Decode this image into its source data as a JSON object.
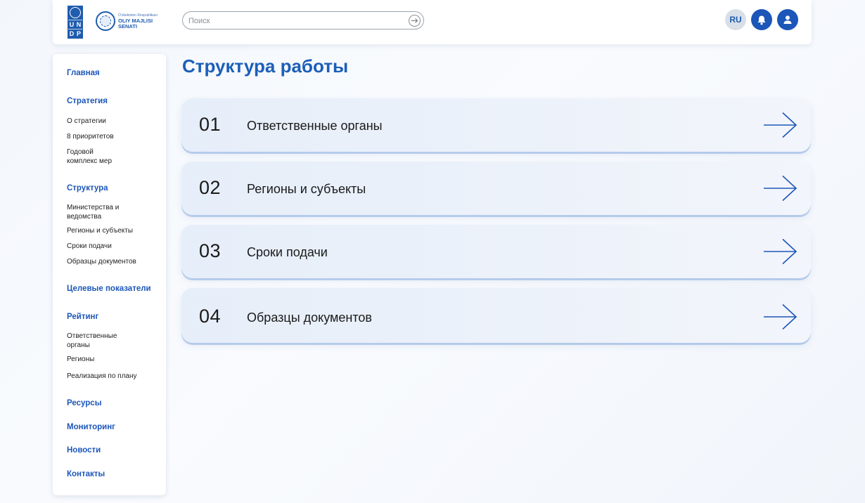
{
  "header": {
    "undp_letters": [
      "U",
      "N",
      "D",
      "P"
    ],
    "senat_logo_subtitle": "O'zbekiston Respublikasi",
    "senat_logo_title_1": "OLIY MAJLISI",
    "senat_logo_title_2": "SENATI",
    "search_placeholder": "Поиск",
    "search_value": "",
    "lang": "RU"
  },
  "sidebar": {
    "home": "Главная",
    "strategy": "Стратегия",
    "strategy_items": [
      "О стратегии",
      "8 приоритетов",
      "Годовой комплекс мер"
    ],
    "structure": "Структура",
    "structure_items": [
      "Министерства и ведомства",
      "Регионы и субъекты",
      "Сроки подачи",
      "Образцы документов"
    ],
    "targets": "Целевые показатели",
    "rating": "Рейтинг",
    "rating_items": [
      "Ответственные органы",
      "Регионы",
      "Реализация по плану"
    ],
    "resources": "Ресурсы",
    "monitoring": "Мониторинг",
    "news": "Новости",
    "contacts": "Контакты"
  },
  "main": {
    "title": "Структура работы",
    "cards": [
      {
        "num": "01",
        "label": "Ответственные органы"
      },
      {
        "num": "02",
        "label": "Регионы и субъекты"
      },
      {
        "num": "03",
        "label": "Сроки подачи"
      },
      {
        "num": "04",
        "label": "Образцы документов"
      }
    ]
  },
  "colors": {
    "accent": "#1c56b8",
    "title": "#1c5fb8",
    "card_bg": "#e6eef9"
  }
}
